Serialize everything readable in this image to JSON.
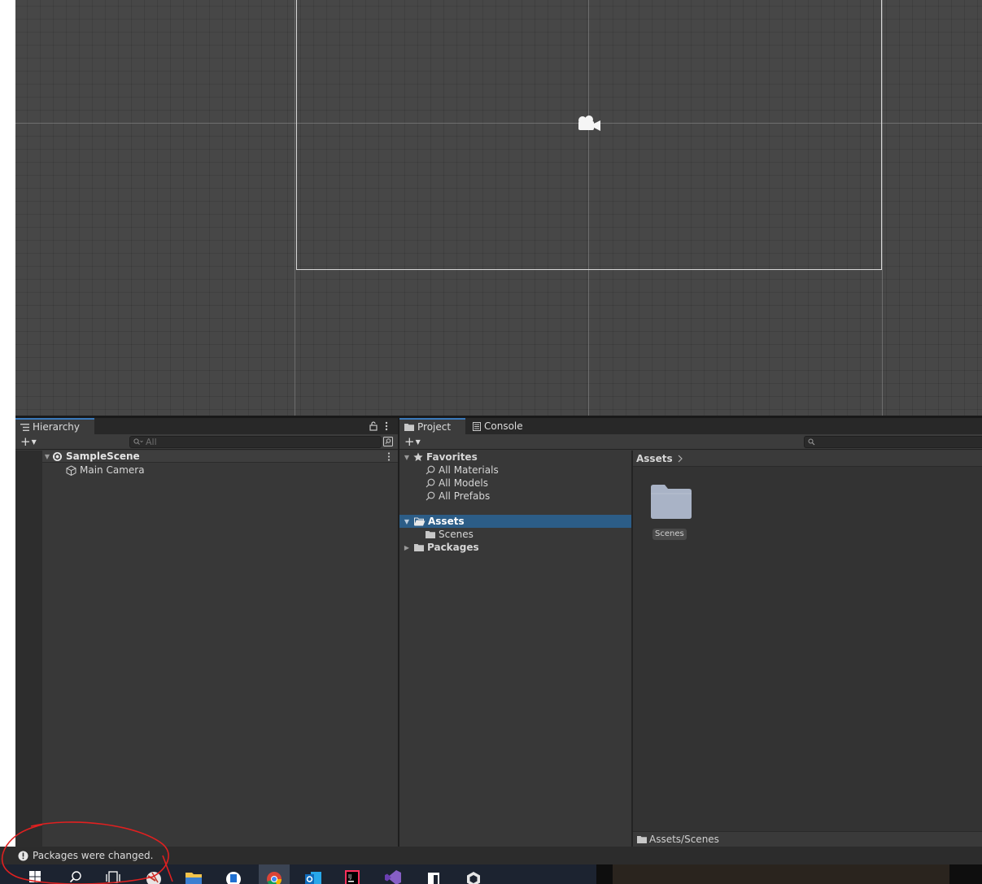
{
  "hierarchy": {
    "tab_label": "Hierarchy",
    "search_placeholder": "All",
    "scene_name": "SampleScene",
    "items": [
      {
        "label": "Main Camera"
      }
    ]
  },
  "project": {
    "tab_project": "Project",
    "tab_console": "Console",
    "favorites": {
      "label": "Favorites",
      "items": [
        {
          "label": "All Materials"
        },
        {
          "label": "All Models"
        },
        {
          "label": "All Prefabs"
        }
      ]
    },
    "assets_label": "Assets",
    "scenes_label": "Scenes",
    "packages_label": "Packages",
    "breadcrumb": "Assets",
    "grid_item": "Scenes",
    "path": "Assets/Scenes"
  },
  "status": {
    "message": "Packages were changed."
  },
  "colors": {
    "selection": "#2c5d87",
    "panel": "#383838",
    "annotation": "#e02020"
  },
  "taskbar": {
    "icons": [
      "windows-start-icon",
      "search-icon",
      "task-view-icon",
      "app-icon",
      "file-explorer-icon",
      "app-icon",
      "chrome-icon",
      "outlook-icon",
      "intellij-icon",
      "visual-studio-icon",
      "notepad-icon",
      "unity-icon"
    ]
  }
}
